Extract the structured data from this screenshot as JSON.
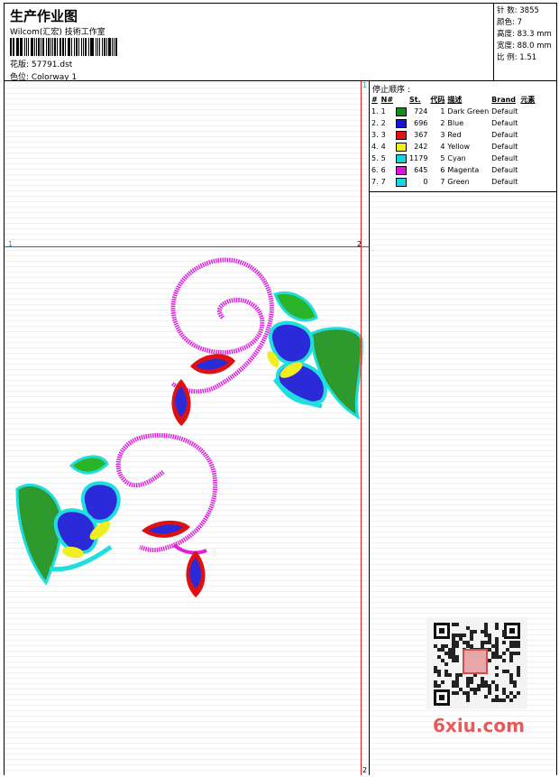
{
  "header": {
    "title": "生产作业图",
    "company": "Wilcom(汇宏) 技術工作室",
    "design_label": "花版: 57791.dst",
    "colorway_label": "色位:  Colorway 1"
  },
  "stats": {
    "stitches": "针 数: 3855",
    "colors": "颜色: 7",
    "height": "高度: 83.3 mm",
    "width": "宽度: 88.0 mm",
    "scale": "比 例: 1.51"
  },
  "markers": {
    "top_right": "1",
    "left_mid": "1",
    "right_mid": "2",
    "bottom_right": "2"
  },
  "stop_sequence": {
    "title": "停止顺序 :",
    "columns": [
      "#",
      "N#",
      "St.",
      "代码",
      "描述",
      "Brand",
      "元素"
    ],
    "rows": [
      {
        "idx": "1.",
        "n": "1",
        "color": "#1a8a1a",
        "st": "724",
        "code": "1",
        "desc": "Dark Green",
        "brand": "Default"
      },
      {
        "idx": "2.",
        "n": "2",
        "color": "#1414d8",
        "st": "696",
        "code": "2",
        "desc": "Blue",
        "brand": "Default"
      },
      {
        "idx": "3.",
        "n": "3",
        "color": "#e01414",
        "st": "367",
        "code": "3",
        "desc": "Red",
        "brand": "Default"
      },
      {
        "idx": "4.",
        "n": "4",
        "color": "#f0f014",
        "st": "242",
        "code": "4",
        "desc": "Yellow",
        "brand": "Default"
      },
      {
        "idx": "5.",
        "n": "5",
        "color": "#14d8d8",
        "st": "1179",
        "code": "5",
        "desc": "Cyan",
        "brand": "Default"
      },
      {
        "idx": "6.",
        "n": "6",
        "color": "#e014e0",
        "st": "645",
        "code": "6",
        "desc": "Magenta",
        "brand": "Default"
      },
      {
        "idx": "7.",
        "n": "7",
        "color": "#14d8e8",
        "st": "0",
        "code": "7",
        "desc": "Green",
        "brand": "Default"
      }
    ]
  },
  "watermark": {
    "brand_text": "6xiu.com"
  }
}
